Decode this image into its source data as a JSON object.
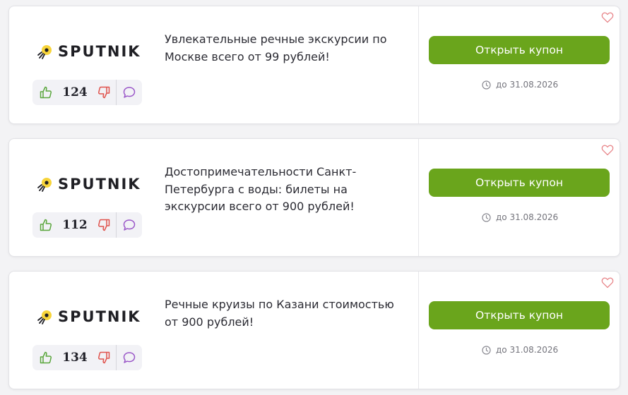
{
  "colors": {
    "button_green": "#6aa51c",
    "like_green": "#5aa63c",
    "dislike_red": "#e0524c",
    "comment_purple": "#9a57c8",
    "heart_pink": "#e8868a",
    "logo_yellow": "#f7d43a"
  },
  "icons": [
    "sputnik-logo-icon",
    "thumbs-up-icon",
    "thumbs-down-icon",
    "comment-icon",
    "clock-icon",
    "heart-icon"
  ],
  "coupons": [
    {
      "brand": "SPUTNIK",
      "title": "Увлекательные речные экскурсии по Москве всего от 99 рублей!",
      "votes": "124",
      "button_label": "Открыть купон",
      "expiry": "до 31.08.2026"
    },
    {
      "brand": "SPUTNIK",
      "title": "Достопримечательности Санкт-Петербурга с воды: билеты на экскурсии всего от 900 рублей!",
      "votes": "112",
      "button_label": "Открыть купон",
      "expiry": "до 31.08.2026"
    },
    {
      "brand": "SPUTNIK",
      "title": "Речные круизы по Казани стоимостью от 900 рублей!",
      "votes": "134",
      "button_label": "Открыть купон",
      "expiry": "до 31.08.2026"
    }
  ]
}
